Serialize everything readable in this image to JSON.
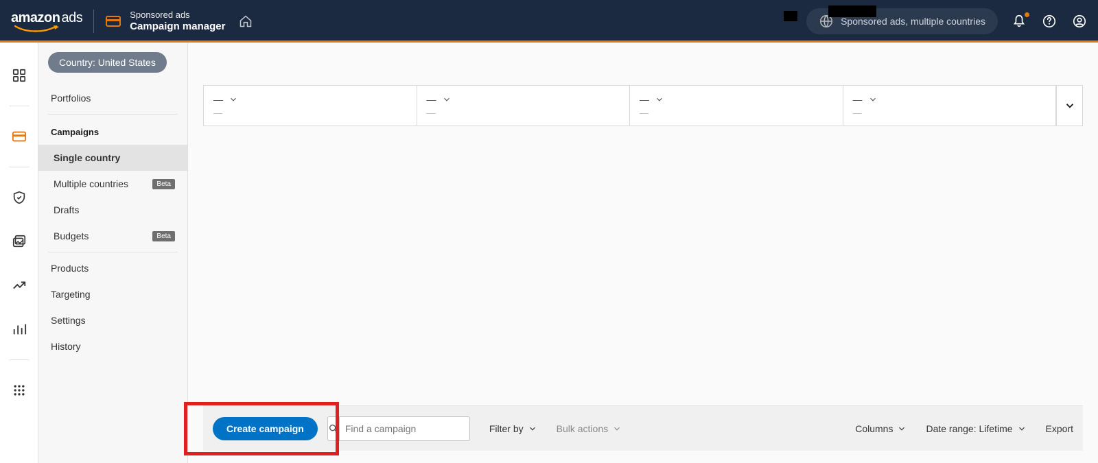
{
  "header": {
    "logo_amazon": "amazon",
    "logo_ads": "ads",
    "crumb_line1": "Sponsored ads",
    "crumb_line2": "Campaign manager",
    "account_pill": "Sponsored ads, multiple countries"
  },
  "sidebar": {
    "country_pill": "Country: United States",
    "portfolios": "Portfolios",
    "campaigns_label": "Campaigns",
    "single_country": "Single country",
    "multiple_countries": "Multiple countries",
    "drafts": "Drafts",
    "budgets": "Budgets",
    "beta": "Beta",
    "products": "Products",
    "targeting": "Targeting",
    "settings": "Settings",
    "history": "History"
  },
  "metrics": {
    "dash": "—",
    "placeholder": "—"
  },
  "toolbar": {
    "create_campaign": "Create campaign",
    "search_placeholder": "Find a campaign",
    "filter_by": "Filter by",
    "bulk_actions": "Bulk actions",
    "columns": "Columns",
    "date_range": "Date range: Lifetime",
    "export": "Export"
  }
}
